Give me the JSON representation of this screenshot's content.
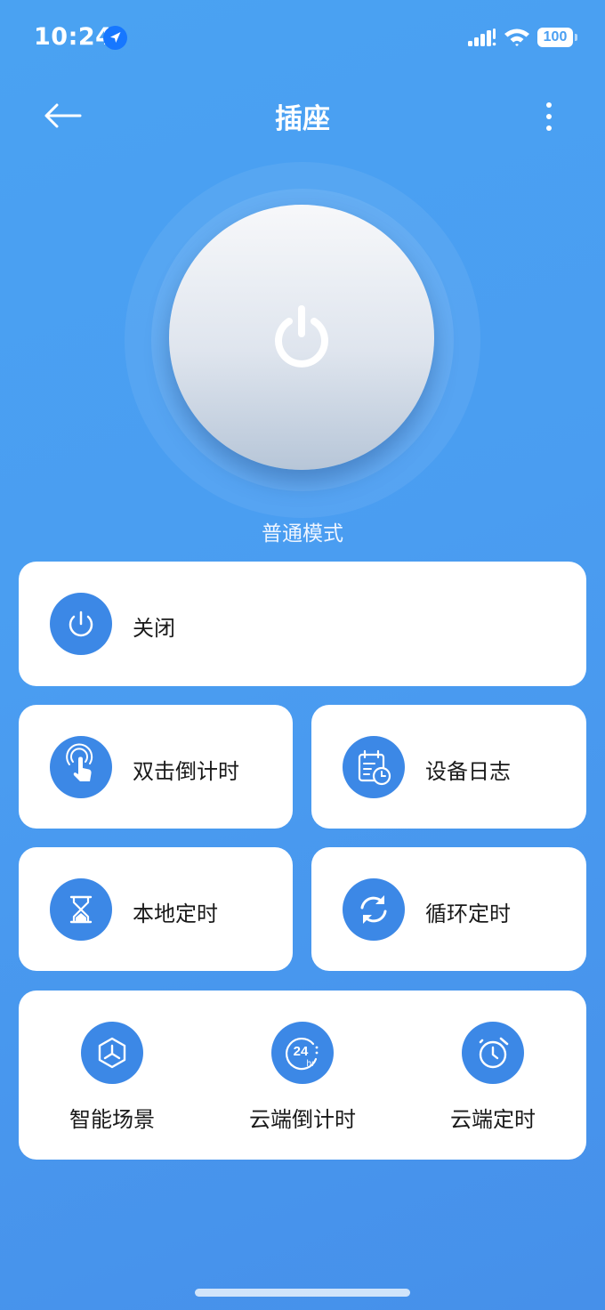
{
  "status_bar": {
    "time": "10:24",
    "battery": "100"
  },
  "header": {
    "title": "插座"
  },
  "main": {
    "mode_label": "普通模式"
  },
  "cards": {
    "power_off": {
      "label": "关闭",
      "icon": "power-icon"
    },
    "double_tap_countdown": {
      "label": "双击倒计时",
      "icon": "tap-hand-icon"
    },
    "device_log": {
      "label": "设备日志",
      "icon": "calendar-clock-icon"
    },
    "local_timer": {
      "label": "本地定时",
      "icon": "hourglass-icon"
    },
    "cycle_timer": {
      "label": "循环定时",
      "icon": "refresh-icon"
    }
  },
  "bottom_row": [
    {
      "label": "智能场景",
      "icon": "hexagon-scene-icon"
    },
    {
      "label": "云端倒计时",
      "icon": "24hr-icon"
    },
    {
      "label": "云端定时",
      "icon": "stopwatch-icon"
    }
  ],
  "colors": {
    "accent": "#3c88e6",
    "background": "#4a9df1",
    "card": "#ffffff"
  }
}
